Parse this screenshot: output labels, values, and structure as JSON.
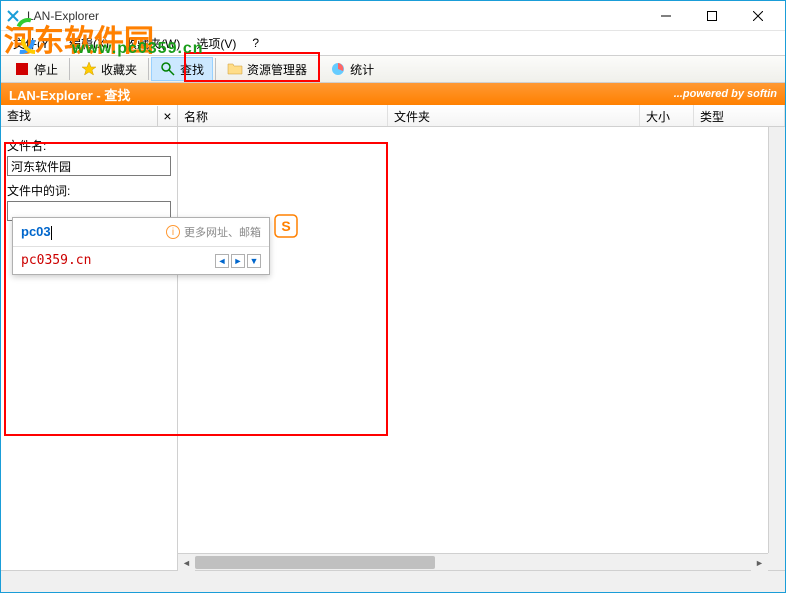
{
  "window": {
    "title": "LAN-Explorer"
  },
  "menubar": {
    "file": "文件(Y)",
    "edit": "编辑(X)",
    "favorites": "收藏夹(W)",
    "options": "选项(V)",
    "help": "?"
  },
  "toolbar": {
    "stop": "停止",
    "favorites": "收藏夹",
    "search": "查找",
    "resource_manager": "资源管理器",
    "statistics": "统计"
  },
  "header_strip": {
    "title": "LAN-Explorer - 查找",
    "powered_prefix": "...powered by ",
    "powered_brand": "softin"
  },
  "sidebar": {
    "header": "查找",
    "filename_label": "文件名:",
    "filename_value": "河东软件园",
    "words_label": "文件中的词:",
    "words_value": ""
  },
  "columns": {
    "name": "名称",
    "folder": "文件夹",
    "size": "大小",
    "type": "类型"
  },
  "ime": {
    "input": "pc03",
    "hint": "更多网址、邮箱",
    "suggestion": "pc0359.cn"
  },
  "watermark": {
    "text": "河东软件园",
    "url_part1": "www.p",
    "url_part2": "c0359.cn"
  }
}
